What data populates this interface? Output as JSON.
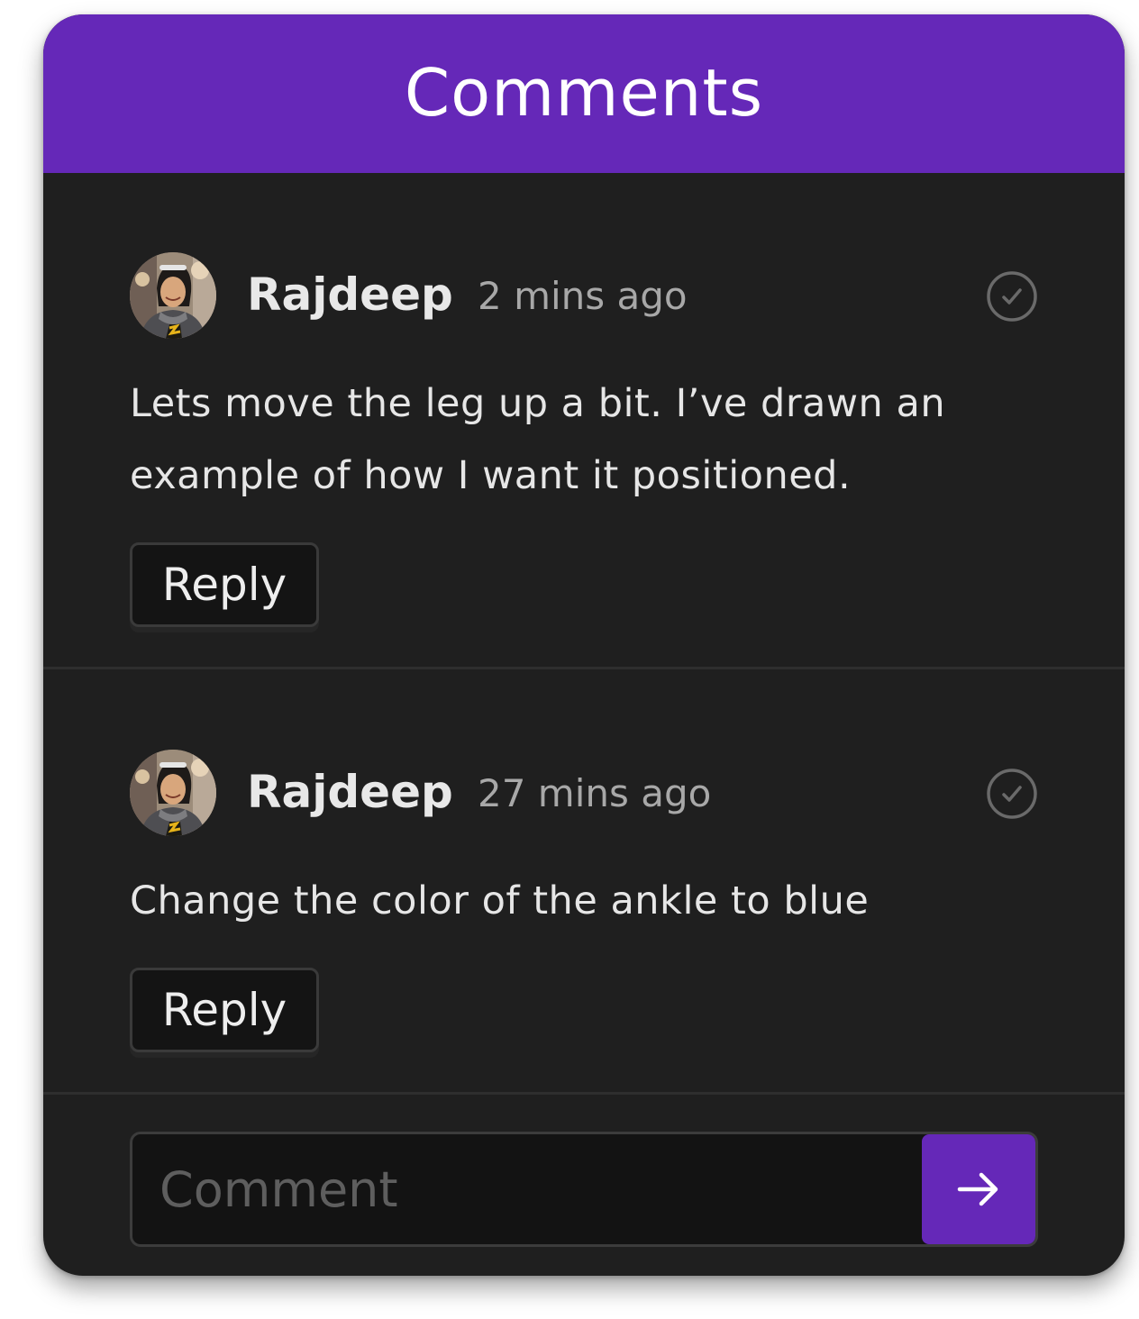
{
  "header": {
    "title": "Comments"
  },
  "comments": [
    {
      "author": "Rajdeep",
      "time": "2 mins ago",
      "lines": [
        "Lets move the leg up a bit. I’ve drawn an",
        "example of how I want it positioned."
      ],
      "reply_label": "Reply",
      "resolve_icon": "check-circle-icon"
    },
    {
      "author": "Rajdeep",
      "time": "27 mins ago",
      "lines": [
        "Change the color of the ankle to blue"
      ],
      "reply_label": "Reply",
      "resolve_icon": "check-circle-icon"
    }
  ],
  "composer": {
    "placeholder": "Comment",
    "value": "",
    "send_icon": "arrow-right-icon"
  },
  "colors": {
    "accent": "#6528b8",
    "panel_bg": "#1f1f1f",
    "input_bg": "#131313",
    "text": "#e6e6e6",
    "muted": "#a8a8a8"
  }
}
